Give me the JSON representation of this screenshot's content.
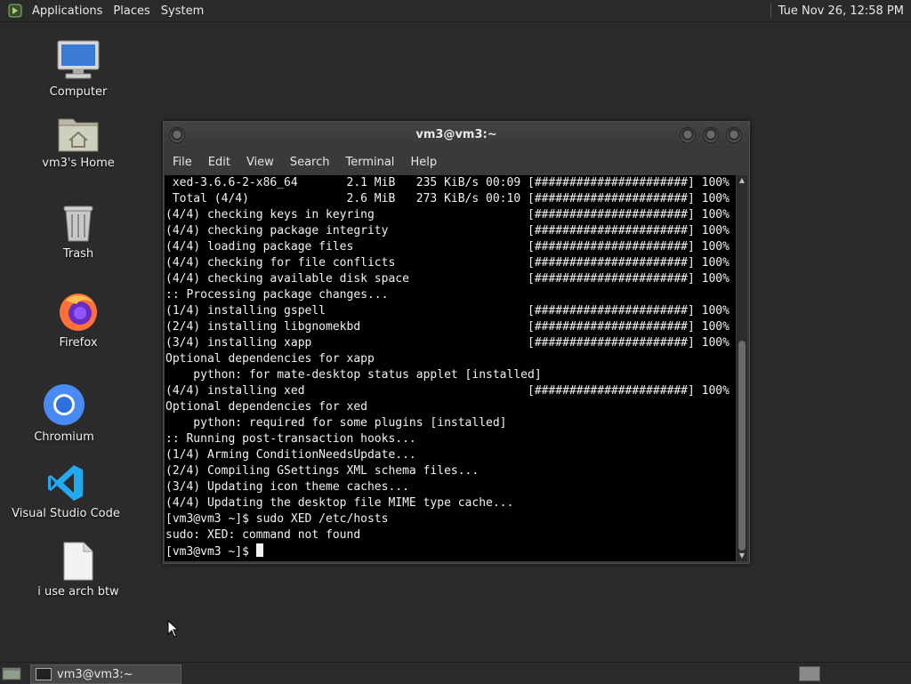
{
  "top_panel": {
    "menus": [
      "Applications",
      "Places",
      "System"
    ],
    "clock": "Tue Nov 26, 12:58 PM"
  },
  "desktop_icons": [
    {
      "label": "Computer",
      "icon": "computer-icon"
    },
    {
      "label": "vm3's Home",
      "icon": "home-folder-icon"
    },
    {
      "label": "Trash",
      "icon": "trash-icon"
    },
    {
      "label": "Firefox",
      "icon": "firefox-icon"
    },
    {
      "label": "Chromium",
      "icon": "chromium-icon"
    },
    {
      "label": "Visual Studio Code",
      "icon": "vscode-icon"
    },
    {
      "label": "i use arch btw",
      "icon": "text-file-icon"
    }
  ],
  "terminal": {
    "title": "vm3@vm3:~",
    "menu": [
      "File",
      "Edit",
      "View",
      "Search",
      "Terminal",
      "Help"
    ],
    "lines": [
      " xed-3.6.6-2-x86_64       2.1 MiB   235 KiB/s 00:09 [######################] 100%",
      " Total (4/4)              2.6 MiB   273 KiB/s 00:10 [######################] 100%",
      "(4/4) checking keys in keyring                      [######################] 100%",
      "(4/4) checking package integrity                    [######################] 100%",
      "(4/4) loading package files                         [######################] 100%",
      "(4/4) checking for file conflicts                   [######################] 100%",
      "(4/4) checking available disk space                 [######################] 100%",
      ":: Processing package changes...",
      "(1/4) installing gspell                             [######################] 100%",
      "(2/4) installing libgnomekbd                        [######################] 100%",
      "(3/4) installing xapp                               [######################] 100%",
      "Optional dependencies for xapp",
      "    python: for mate-desktop status applet [installed]",
      "(4/4) installing xed                                [######################] 100%",
      "Optional dependencies for xed",
      "    python: required for some plugins [installed]",
      ":: Running post-transaction hooks...",
      "(1/4) Arming ConditionNeedsUpdate...",
      "(2/4) Compiling GSettings XML schema files...",
      "(3/4) Updating icon theme caches...",
      "(4/4) Updating the desktop file MIME type cache...",
      "[vm3@vm3 ~]$ sudo XED /etc/hosts",
      "sudo: XED: command not found"
    ],
    "prompt": "[vm3@vm3 ~]$ "
  },
  "taskbar": {
    "task_label": "vm3@vm3:~"
  },
  "colors": {
    "desktop_bg": "#2b2b2b",
    "panel_bg": "#2a2a2a",
    "terminal_bg": "#000000",
    "terminal_fg": "#f2f2f2"
  }
}
